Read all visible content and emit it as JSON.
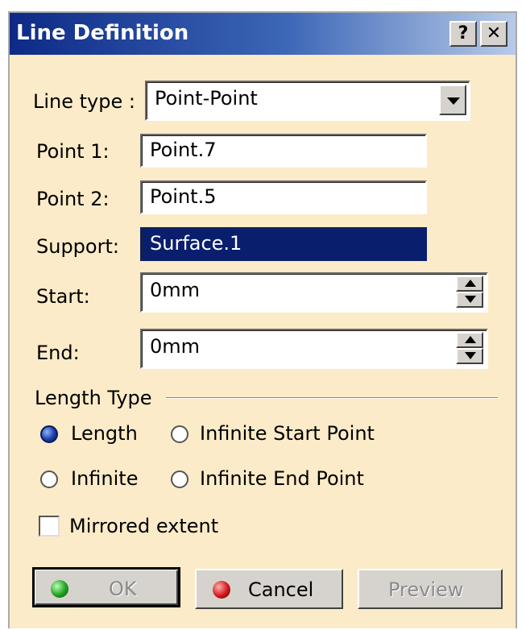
{
  "window": {
    "title": "Line Definition",
    "help_label": "?",
    "close_label": "✕"
  },
  "form": {
    "line_type": {
      "label": "Line type :",
      "value": "Point-Point"
    },
    "point1": {
      "label": "Point 1:",
      "value": "Point.7"
    },
    "point2": {
      "label": "Point 2:",
      "value": "Point.5"
    },
    "support": {
      "label": "Support:",
      "value": "Surface.1"
    },
    "start": {
      "label": "Start:",
      "value": "0mm"
    },
    "end": {
      "label": "End:",
      "value": "0mm"
    }
  },
  "length_type": {
    "group_label": "Length Type",
    "options": [
      {
        "label": "Length",
        "selected": true
      },
      {
        "label": "Infinite Start Point",
        "selected": false
      },
      {
        "label": "Infinite",
        "selected": false
      },
      {
        "label": "Infinite End Point",
        "selected": false
      }
    ]
  },
  "mirrored": {
    "label": "Mirrored extent",
    "checked": false
  },
  "buttons": {
    "ok": "OK",
    "cancel": "Cancel",
    "preview": "Preview"
  },
  "colors": {
    "dialog_bg": "#fcebc8",
    "selected_bg": "#0a1e6e",
    "titlebar_start": "#0d2a86"
  }
}
